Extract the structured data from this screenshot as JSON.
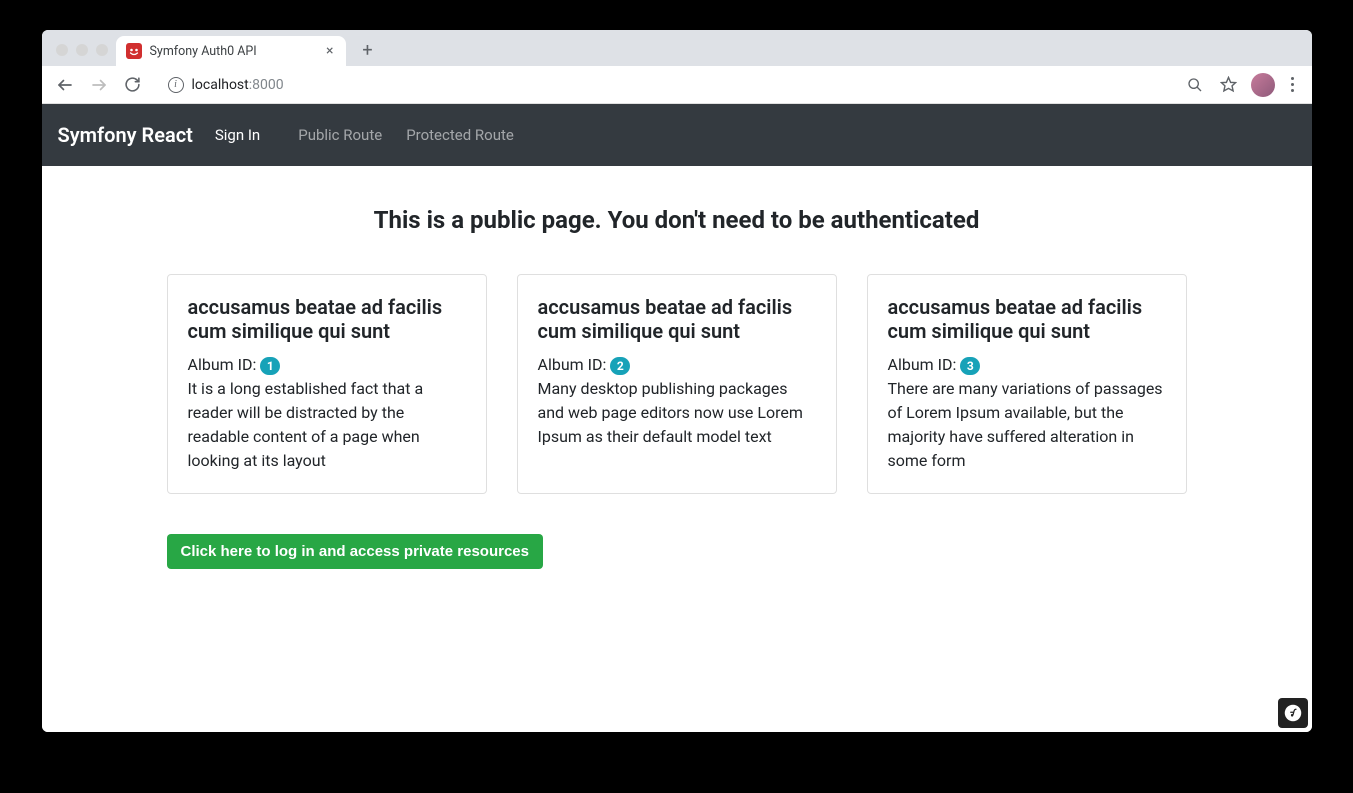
{
  "browser": {
    "tab_title": "Symfony Auth0 API",
    "url_host": "localhost",
    "url_port": ":8000"
  },
  "navbar": {
    "brand": "Symfony React",
    "sign_in": "Sign In",
    "public_route": "Public Route",
    "protected_route": "Protected Route"
  },
  "page": {
    "heading": "This is a public page. You don't need to be authenticated",
    "album_id_label": "Album ID: ",
    "login_button": "Click here to log in and access private resources"
  },
  "cards": [
    {
      "title": "accusamus beatae ad facilis cum similique qui sunt",
      "album_id": "1",
      "description": "It is a long established fact that a reader will be distracted by the readable content of a page when looking at its layout"
    },
    {
      "title": "accusamus beatae ad facilis cum similique qui sunt",
      "album_id": "2",
      "description": "Many desktop publishing packages and web page editors now use Lorem Ipsum as their default model text"
    },
    {
      "title": "accusamus beatae ad facilis cum similique qui sunt",
      "album_id": "3",
      "description": "There are many variations of passages of Lorem Ipsum available, but the majority have suffered alteration in some form"
    }
  ]
}
